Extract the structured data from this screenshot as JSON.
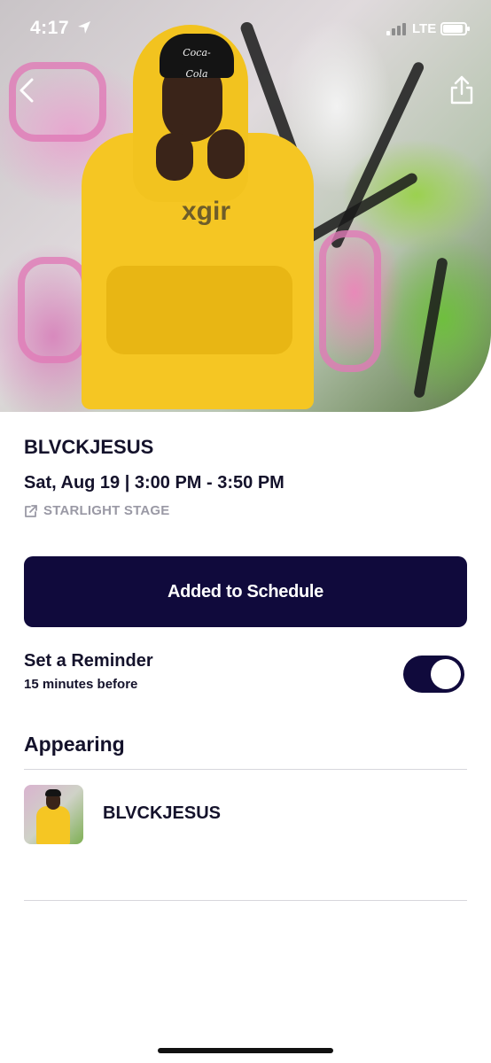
{
  "status_bar": {
    "time": "4:17",
    "network": "LTE"
  },
  "hero": {
    "cap_text": "Coca-Cola",
    "hoodie_print": "xgir"
  },
  "event": {
    "artist": "BLVCKJESUS",
    "datetime": "Sat, Aug 19 | 3:00 PM - 3:50 PM",
    "stage": "STARLIGHT STAGE"
  },
  "schedule_button": {
    "label": "Added to Schedule"
  },
  "reminder": {
    "title": "Set a Reminder",
    "subtitle": "15 minutes before",
    "enabled": true
  },
  "appearing": {
    "title": "Appearing",
    "performers": [
      {
        "name": "BLVCKJESUS"
      }
    ]
  },
  "icons": {
    "back": "chevron-left-icon",
    "share": "share-icon",
    "stage_link": "external-link-icon",
    "location": "location-arrow-icon"
  },
  "colors": {
    "primary": "#100a3c",
    "text": "#14122b",
    "muted": "#9a99a5",
    "hoodie": "#f5c623"
  }
}
